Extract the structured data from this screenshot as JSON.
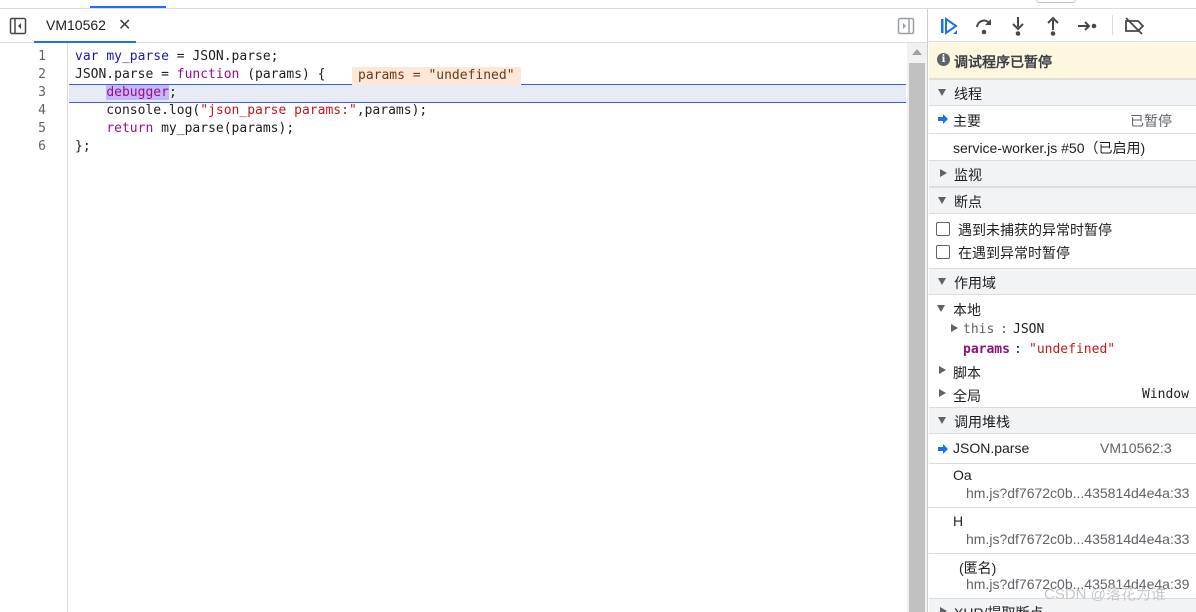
{
  "editor": {
    "tab_name": "VM10562",
    "lines": [
      "1",
      "2",
      "3",
      "4",
      "5",
      "6"
    ],
    "code": {
      "l1_kw": "var",
      "l1_var": "my_parse",
      "l1_rest": " = JSON.parse;",
      "l2_a": "JSON.parse = ",
      "l2_kw": "function",
      "l2_b": " (params) {",
      "l2_inline": "params = \"undefined\"",
      "l3_kw": "debugger",
      "l3_rest": ";",
      "l4_a": "    console.log(",
      "l4_str": "\"json_parse params:\"",
      "l4_b": ",params);",
      "l5_kw": "return",
      "l5_rest": " my_parse(params);",
      "l6": "};"
    }
  },
  "sidebar": {
    "paused_text": "调试程序已暂停",
    "threads": {
      "title": "线程",
      "main_label": "主要",
      "main_status": "已暂停",
      "worker": "service-worker.js #50（已启用)"
    },
    "watch_title": "监视",
    "breakpoints": {
      "title": "断点",
      "opt1": "遇到未捕获的异常时暂停",
      "opt2": "在遇到异常时暂停"
    },
    "scope": {
      "title": "作用域",
      "local": "本地",
      "this_key": "this",
      "this_val": "JSON",
      "params_key": "params",
      "params_val": "\"undefined\"",
      "script": "脚本",
      "global": "全局",
      "global_val": "Window"
    },
    "callstack": {
      "title": "调用堆栈",
      "frames": [
        {
          "name": "JSON.parse",
          "loc": "VM10562:3"
        },
        {
          "name": "Oa",
          "loc": "hm.js?df7672c0b...435814d4e4a:33"
        },
        {
          "name": "H",
          "loc": "hm.js?df7672c0b...435814d4e4a:33"
        },
        {
          "name": "(匿名)",
          "loc": "hm.js?df7672c0b...435814d4e4a:39"
        }
      ]
    },
    "xhr_title": "XHR/提取断点"
  },
  "watermark": "CSDN @落花为谁",
  "colors": {
    "accent": "#1a73e8",
    "paused_bg": "#fef7e0",
    "keyword": "#9a0c8f",
    "string": "#c41a16"
  }
}
